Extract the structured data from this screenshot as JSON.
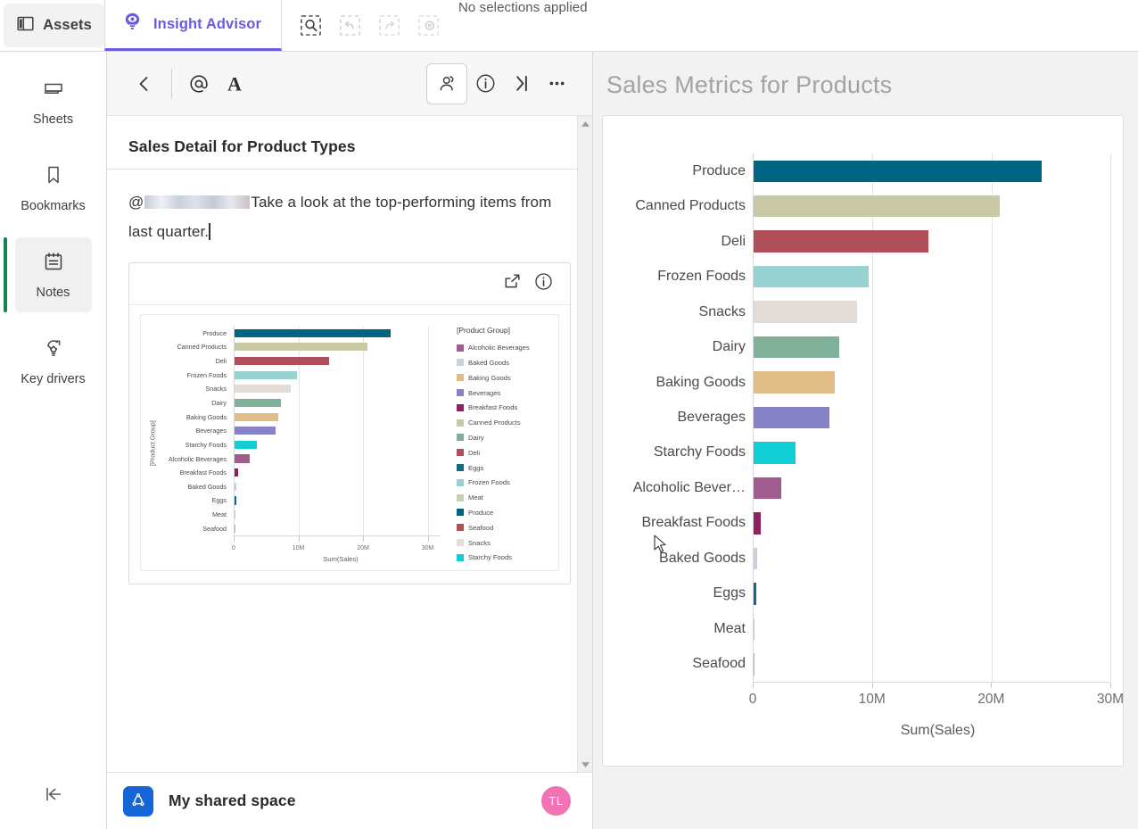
{
  "topbar": {
    "assets_label": "Assets",
    "insight_advisor_label": "Insight Advisor",
    "selection_message": "No selections applied",
    "tools": [
      {
        "name": "selection-search",
        "state": "enabled"
      },
      {
        "name": "step-back",
        "state": "disabled"
      },
      {
        "name": "step-forward",
        "state": "disabled"
      },
      {
        "name": "clear-all-selections",
        "state": "disabled"
      }
    ]
  },
  "rail": {
    "items": [
      {
        "label": "Sheets",
        "icon": "sheets-icon",
        "active": false
      },
      {
        "label": "Bookmarks",
        "icon": "bookmark-icon",
        "active": false
      },
      {
        "label": "Notes",
        "icon": "notes-icon",
        "active": true
      },
      {
        "label": "Key drivers",
        "icon": "key-drivers-icon",
        "active": false
      }
    ],
    "collapse_icon": "collapse-left-icon"
  },
  "notes": {
    "toolbar": [
      {
        "name": "back-button",
        "glyph": "chevron-left"
      },
      {
        "name": "mention-button",
        "glyph": "at-sign"
      },
      {
        "name": "text-format-button",
        "glyph": "letter-a"
      },
      {
        "name": "share-people-button",
        "glyph": "people",
        "selected": true
      },
      {
        "name": "info-button",
        "glyph": "info-circle"
      },
      {
        "name": "collapse-panel-button",
        "glyph": "chevron-right-bar"
      },
      {
        "name": "more-options-button",
        "glyph": "ellipsis"
      }
    ],
    "title": "Sales Detail for Product Types",
    "mention_prefix": "@",
    "body_text_part1": "Take a look at the top-performing",
    "body_text_part2": "items from last quarter.",
    "card": {
      "share_icon": "share-export-icon",
      "info_icon": "info-circle-icon"
    },
    "footer": {
      "space_name": "My shared space",
      "space_icon": "shared-space-icon",
      "avatar_initials": "TL"
    }
  },
  "main": {
    "title": "Sales Metrics for Products"
  },
  "colors": {
    "accent_purple": "#6a5ce0",
    "notes_active_green": "#13854e",
    "space_blue": "#1565d8",
    "avatar_pink": "#f272b6",
    "title_gray": "#a3a3a3"
  },
  "chart_data": [
    {
      "id": "main-bar-chart",
      "type": "bar",
      "orientation": "horizontal",
      "title": "Sales Metrics for Products",
      "xlabel": "Sum(Sales)",
      "ylabel": "",
      "xlim": [
        0,
        30000000
      ],
      "xticks": [
        0,
        10000000,
        20000000,
        30000000
      ],
      "xticklabels": [
        "0",
        "10M",
        "20M",
        "30M"
      ],
      "grid": true,
      "legend": false,
      "categories": [
        "Produce",
        "Canned Products",
        "Deli",
        "Frozen Foods",
        "Snacks",
        "Dairy",
        "Baking Goods",
        "Beverages",
        "Starchy Foods",
        "Alcoholic Bever…",
        "Breakfast Foods",
        "Baked Goods",
        "Eggs",
        "Meat",
        "Seafood"
      ],
      "values": [
        24200000,
        20700000,
        14700000,
        9700000,
        8700000,
        7200000,
        6800000,
        6400000,
        3500000,
        2300000,
        600000,
        330000,
        260000,
        90000,
        70000
      ],
      "colors": [
        "#006580",
        "#c9c9a5",
        "#b04f5a",
        "#97d2d1",
        "#e3dcd6",
        "#80b099",
        "#e0bc87",
        "#8883c8",
        "#11cdd4",
        "#a05c8e",
        "#8d2260",
        "#c7d2dd",
        "#116b84",
        "#ccceb3",
        "#d9a7ae"
      ]
    },
    {
      "id": "note-embedded-bar-chart",
      "type": "bar",
      "orientation": "horizontal",
      "title": "",
      "xlabel": "Sum(Sales)",
      "ylabel": "[Product Group]",
      "xlim": [
        0,
        32000000
      ],
      "xticks": [
        0,
        10000000,
        20000000,
        30000000
      ],
      "xticklabels": [
        "0",
        "10M",
        "20M",
        "30M"
      ],
      "grid": true,
      "legend": true,
      "legend_position": "right",
      "legend_title": "[Product Group]",
      "categories": [
        "Produce",
        "Canned Products",
        "Deli",
        "Frozen Foods",
        "Snacks",
        "Dairy",
        "Baking Goods",
        "Beverages",
        "Starchy Foods",
        "Alcoholic Beverages",
        "Breakfast Foods",
        "Baked Goods",
        "Eggs",
        "Meat",
        "Seafood"
      ],
      "values": [
        24200000,
        20700000,
        14700000,
        9700000,
        8700000,
        7200000,
        6800000,
        6400000,
        3500000,
        2300000,
        600000,
        330000,
        260000,
        90000,
        70000
      ],
      "colors": [
        "#006580",
        "#c9c9a5",
        "#b04f5a",
        "#97d2d1",
        "#e3dcd6",
        "#80b099",
        "#e0bc87",
        "#8883c8",
        "#11cdd4",
        "#a05c8e",
        "#8d2260",
        "#c7d2dd",
        "#116b84",
        "#ccceb3",
        "#d9a7ae"
      ],
      "legend_entries": [
        {
          "label": "Alcoholic Beverages",
          "color": "#a05c8e"
        },
        {
          "label": "Baked Goods",
          "color": "#c7d2dd"
        },
        {
          "label": "Baking Goods",
          "color": "#e0bc87"
        },
        {
          "label": "Beverages",
          "color": "#8883c8"
        },
        {
          "label": "Breakfast Foods",
          "color": "#8d2260"
        },
        {
          "label": "Canned Products",
          "color": "#c9c9a5"
        },
        {
          "label": "Dairy",
          "color": "#80b099"
        },
        {
          "label": "Deli",
          "color": "#b04f5a"
        },
        {
          "label": "Eggs",
          "color": "#116b84"
        },
        {
          "label": "Frozen Foods",
          "color": "#97d2d1"
        },
        {
          "label": "Meat",
          "color": "#ccceb3"
        },
        {
          "label": "Produce",
          "color": "#006580"
        },
        {
          "label": "Seafood",
          "color": "#b04f5a"
        },
        {
          "label": "Snacks",
          "color": "#e3dcd6"
        },
        {
          "label": "Starchy Foods",
          "color": "#11cdd4"
        }
      ]
    }
  ]
}
